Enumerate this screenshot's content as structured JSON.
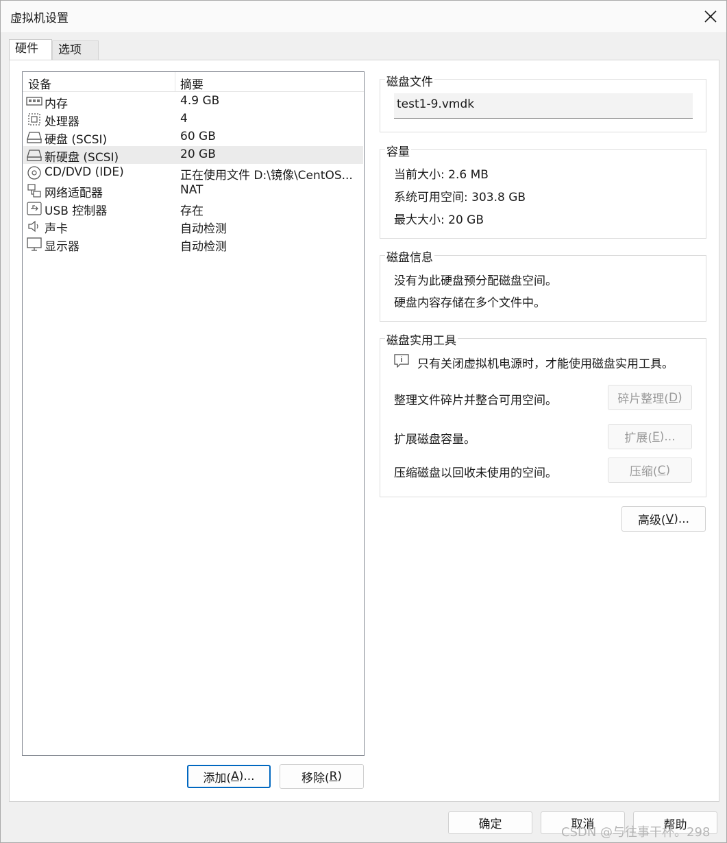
{
  "window": {
    "title": "虚拟机设置"
  },
  "tabs": [
    {
      "label": "硬件"
    },
    {
      "label": "选项"
    }
  ],
  "device_list": {
    "headers": {
      "device": "设备",
      "summary": "摘要"
    },
    "rows": [
      {
        "icon": "memory-icon",
        "name": "内存",
        "summary": "4.9 GB"
      },
      {
        "icon": "processor-icon",
        "name": "处理器",
        "summary": "4"
      },
      {
        "icon": "harddisk-icon",
        "name": "硬盘 (SCSI)",
        "summary": "60 GB"
      },
      {
        "icon": "harddisk-icon",
        "name": "新硬盘 (SCSI)",
        "summary": "20 GB"
      },
      {
        "icon": "cd-dvd-icon",
        "name": "CD/DVD (IDE)",
        "summary": "正在使用文件 D:\\镜像\\CentOS..."
      },
      {
        "icon": "network-adapter-icon",
        "name": "网络适配器",
        "summary": "NAT"
      },
      {
        "icon": "usb-icon",
        "name": "USB 控制器",
        "summary": "存在"
      },
      {
        "icon": "sound-card-icon",
        "name": "声卡",
        "summary": "自动检测"
      },
      {
        "icon": "display-icon",
        "name": "显示器",
        "summary": "自动检测"
      }
    ],
    "selected_index": 3
  },
  "list_buttons": {
    "add": {
      "label": "添加(",
      "key": "A",
      "suffix": ")..."
    },
    "remove": {
      "label": "移除(",
      "key": "R",
      "suffix": ")"
    }
  },
  "disk_file": {
    "title": "磁盘文件",
    "value": "test1-9.vmdk"
  },
  "capacity": {
    "title": "容量",
    "current": "当前大小: 2.6 MB",
    "available": "系统可用空间: 303.8 GB",
    "max": "最大大小: 20 GB"
  },
  "disk_info": {
    "title": "磁盘信息",
    "line1": "没有为此硬盘预分配磁盘空间。",
    "line2": "硬盘内容存储在多个文件中。"
  },
  "disk_utilities": {
    "title": "磁盘实用工具",
    "notice": "只有关闭虚拟机电源时，才能使用磁盘实用工具。",
    "defrag_desc": "整理文件碎片并整合可用空间。",
    "defrag": {
      "label": "碎片整理(",
      "key": "D",
      "suffix": ")"
    },
    "expand_desc": "扩展磁盘容量。",
    "expand": {
      "label": "扩展(",
      "key": "E",
      "suffix": ")..."
    },
    "compact_desc": "压缩磁盘以回收未使用的空间。",
    "compact": {
      "label": "压缩(",
      "key": "C",
      "suffix": ")"
    }
  },
  "advanced": {
    "label": "高级(",
    "key": "V",
    "suffix": ")..."
  },
  "footer": {
    "ok": "确定",
    "cancel": "取消",
    "help": "帮助"
  },
  "watermark": "CSDN @与往事干杯。298"
}
